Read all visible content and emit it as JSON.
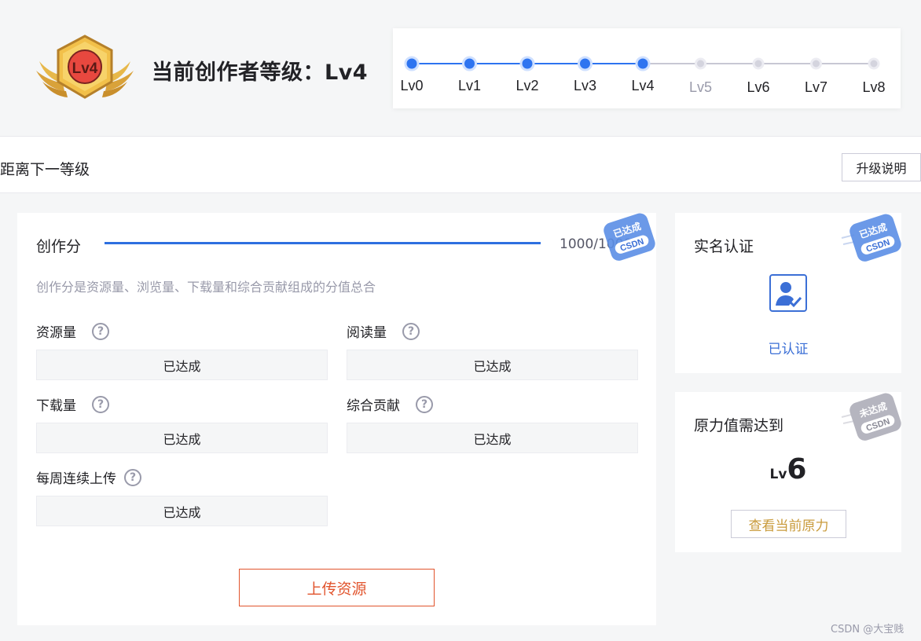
{
  "header": {
    "badge_text": "Lv4",
    "title": "当前创作者等级：Lv4",
    "levels": [
      "Lv0",
      "Lv1",
      "Lv2",
      "Lv3",
      "Lv4",
      "Lv5",
      "Lv6",
      "Lv7",
      "Lv8"
    ],
    "current_level_index": 4,
    "colors": {
      "active": "#2e74f0",
      "inactive": "#c8c8d4",
      "future_label": "#999aaa"
    }
  },
  "next_level": {
    "title": "距离下一等级",
    "upgrade_button": "升级说明"
  },
  "creation": {
    "label": "创作分",
    "progress": 1.0,
    "score": "1000/1000",
    "stamp_text": "已达成",
    "stamp_brand": "CSDN",
    "description": "创作分是资源量、浏览量、下载量和综合贡献组成的分值总合",
    "metrics": [
      {
        "label": "资源量",
        "status": "已达成"
      },
      {
        "label": "阅读量",
        "status": "已达成"
      },
      {
        "label": "下载量",
        "status": "已达成"
      },
      {
        "label": "综合贡献",
        "status": "已达成"
      },
      {
        "label": "每周连续上传",
        "status": "已达成"
      }
    ],
    "upload_button": "上传资源"
  },
  "verification": {
    "title": "实名认证",
    "status": "已认证",
    "stamp_text": "已达成",
    "stamp_brand": "CSDN"
  },
  "power": {
    "title": "原力值需达到",
    "level_prefix": "Lv",
    "level_value": "6",
    "stamp_text": "未达成",
    "stamp_brand": "CSDN",
    "button": "查看当前原力"
  },
  "watermark": "CSDN @大宝贱"
}
